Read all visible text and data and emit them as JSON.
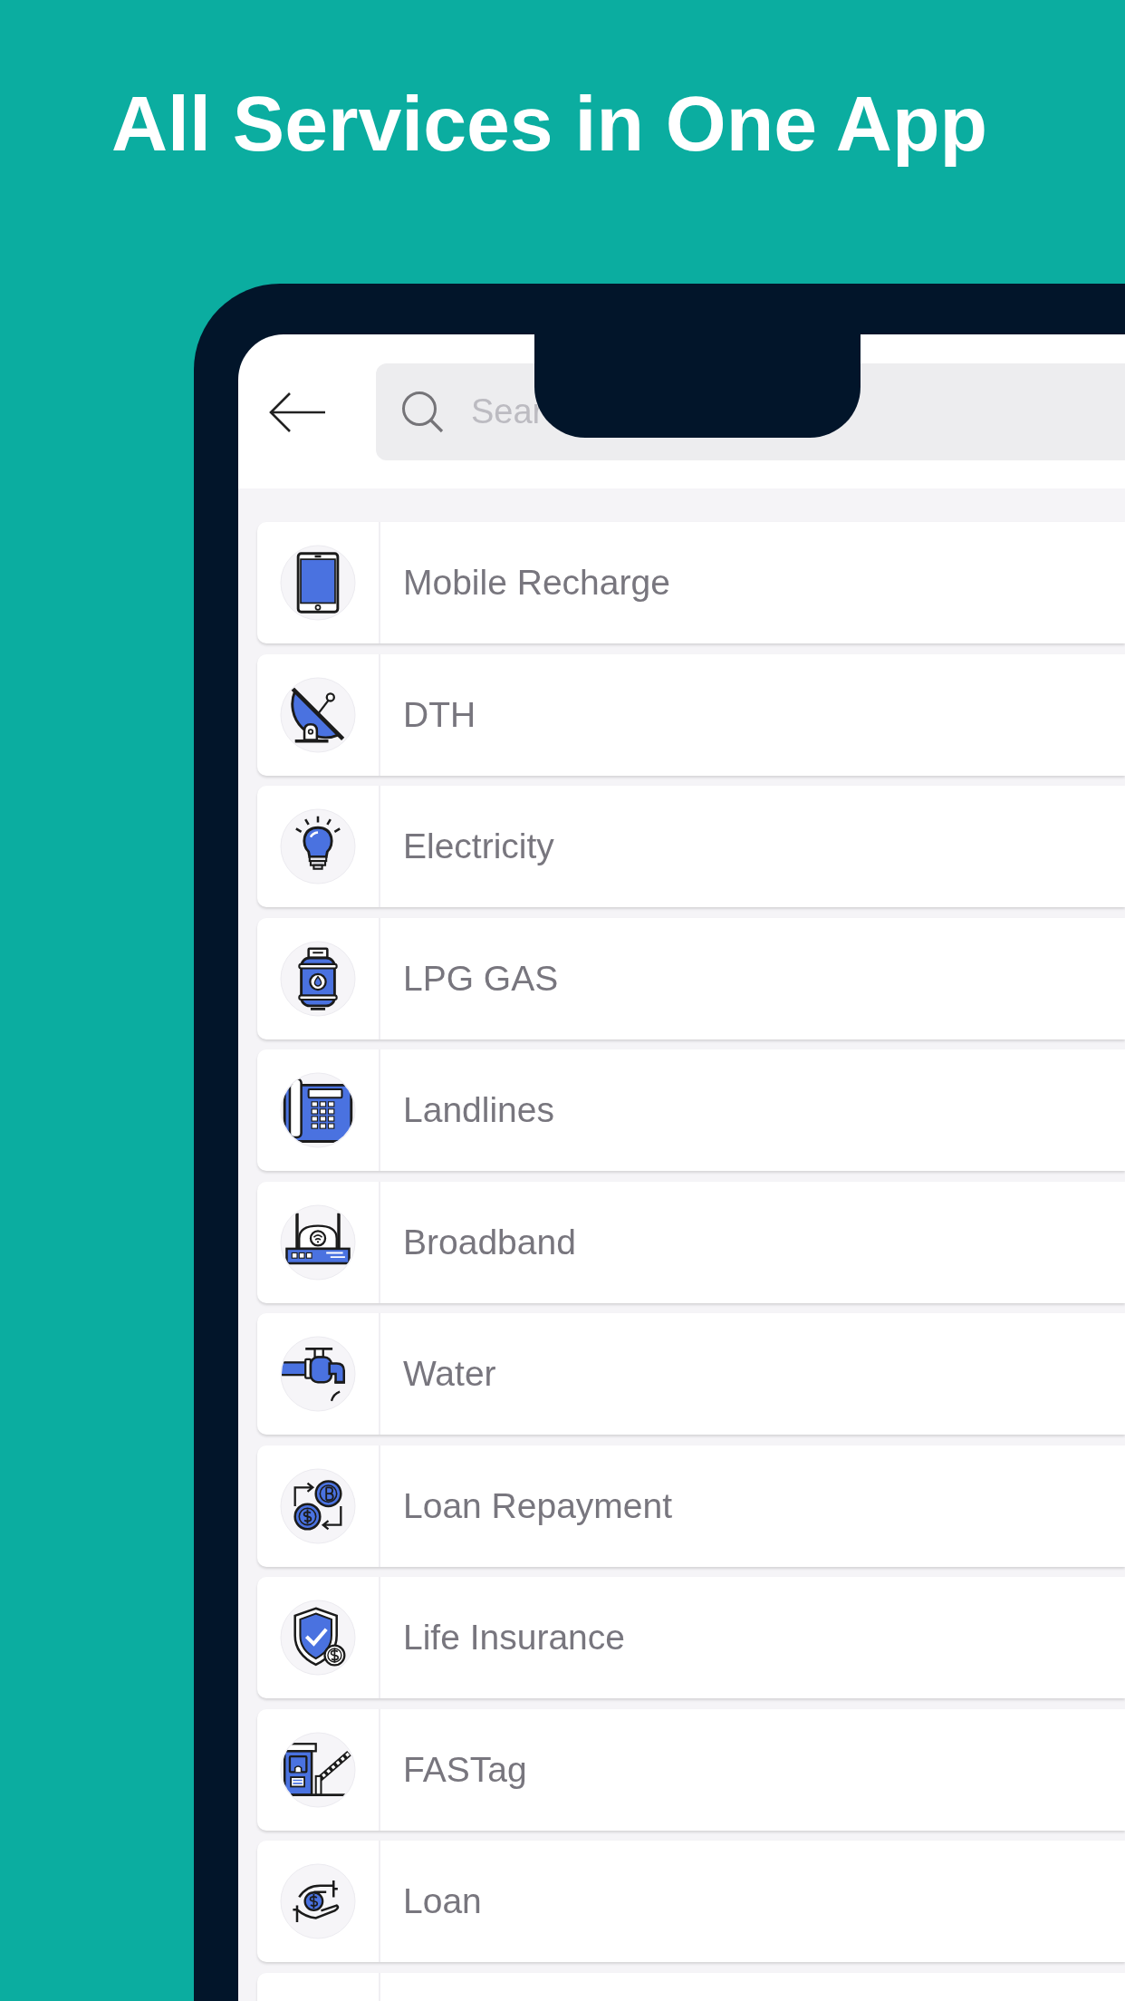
{
  "headline": "All Services in One App",
  "screen": {
    "search": {
      "placeholder": "Sear"
    },
    "services": [
      {
        "label": "Mobile Recharge"
      },
      {
        "label": "DTH"
      },
      {
        "label": "Electricity"
      },
      {
        "label": "LPG GAS"
      },
      {
        "label": "Landlines"
      },
      {
        "label": "Broadband"
      },
      {
        "label": "Water"
      },
      {
        "label": "Loan Repayment"
      },
      {
        "label": "Life Insurance"
      },
      {
        "label": "FASTag"
      },
      {
        "label": "Loan"
      }
    ]
  }
}
